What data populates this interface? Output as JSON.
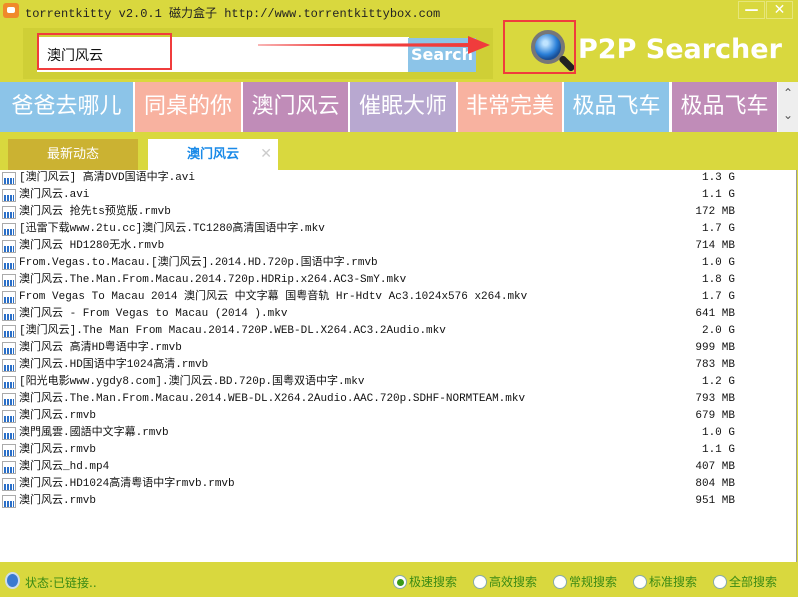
{
  "window": {
    "title": "torrentkitty v2.0.1 磁力盒子 http://www.torrentkittybox.com",
    "minimize": "—",
    "close": "✕"
  },
  "search": {
    "value": "澳门风云",
    "button": "Search"
  },
  "brand": "P2P Searcher",
  "tiles": [
    {
      "label": "爸爸去哪儿",
      "color": "#8cc4e8"
    },
    {
      "label": "同桌的你",
      "color": "#f8b2a0"
    },
    {
      "label": "澳门风云",
      "color": "#c08cb8"
    },
    {
      "label": "催眠大师",
      "color": "#b8a8d0"
    },
    {
      "label": "非常完美",
      "color": "#f8b2a0"
    },
    {
      "label": "极品飞车",
      "color": "#8cc4e8"
    },
    {
      "label": "极品飞车",
      "color": "#c08cb8"
    }
  ],
  "tile_scroll": {
    "up": "⌃",
    "down": "⌄"
  },
  "tabs": [
    {
      "label": "最新动态"
    },
    {
      "label": "澳门风云",
      "close": "✕"
    }
  ],
  "results": [
    {
      "name": "[澳门风云] 高清DVD国语中字.avi",
      "size": "1.3 G"
    },
    {
      "name": "澳门风云.avi",
      "size": "1.1 G"
    },
    {
      "name": "澳门风云 抢先ts预览版.rmvb",
      "size": "172 MB"
    },
    {
      "name": "[迅雷下载www.2tu.cc]澳门风云.TC1280高清国语中字.mkv",
      "size": "1.7 G"
    },
    {
      "name": "澳门风云 HD1280无水.rmvb",
      "size": "714 MB"
    },
    {
      "name": "From.Vegas.to.Macau.[澳门风云].2014.HD.720p.国语中字.rmvb",
      "size": "1.0 G"
    },
    {
      "name": "澳门风云.The.Man.From.Macau.2014.720p.HDRip.x264.AC3-SmY.mkv",
      "size": "1.8 G"
    },
    {
      "name": "From Vegas To Macau 2014 澳门风云 中文字幕 国粤音轨 Hr-Hdtv Ac3.1024x576 x264.mkv",
      "size": "1.7 G"
    },
    {
      "name": "澳门风云 - From Vegas to Macau (2014 ).mkv",
      "size": "641 MB"
    },
    {
      "name": "[澳门风云].The Man From Macau.2014.720P.WEB-DL.X264.AC3.2Audio.mkv",
      "size": "2.0 G"
    },
    {
      "name": "澳门风云 高清HD粤语中字.rmvb",
      "size": "999 MB"
    },
    {
      "name": "澳门风云.HD国语中字1024高清.rmvb",
      "size": "783 MB"
    },
    {
      "name": "[阳光电影www.ygdy8.com].澳门风云.BD.720p.国粤双语中字.mkv",
      "size": "1.2 G"
    },
    {
      "name": "澳门风云.The.Man.From.Macau.2014.WEB-DL.X264.2Audio.AAC.720p.SDHF-NORMTEAM.mkv",
      "size": "793 MB"
    },
    {
      "name": "澳门风云.rmvb",
      "size": "679 MB"
    },
    {
      "name": "澳門風雲.國語中文字幕.rmvb",
      "size": "1.0 G"
    },
    {
      "name": "澳门风云.rmvb",
      "size": "1.1 G"
    },
    {
      "name": "澳门风云_hd.mp4",
      "size": "407 MB"
    },
    {
      "name": "澳门风云.HD1024高清粤语中字rmvb.rmvb",
      "size": "804 MB"
    },
    {
      "name": "澳门风云.rmvb",
      "size": "951 MB"
    }
  ],
  "status": {
    "text": "状态:已链接..",
    "modes": [
      {
        "label": "极速搜索",
        "selected": true
      },
      {
        "label": "高效搜索",
        "selected": false
      },
      {
        "label": "常规搜索",
        "selected": false
      },
      {
        "label": "标准搜索",
        "selected": false
      },
      {
        "label": "全部搜索",
        "selected": false
      }
    ]
  }
}
